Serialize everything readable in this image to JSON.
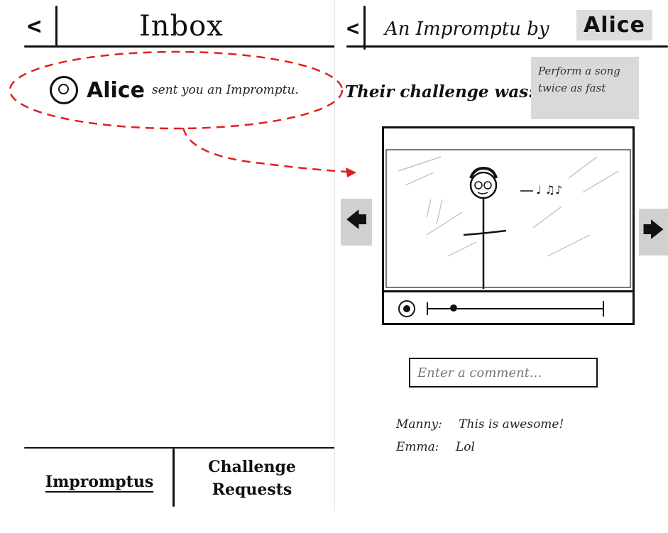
{
  "inbox_screen": {
    "back_label": "<",
    "title": "Inbox",
    "notification": {
      "sender": "Alice",
      "message": "sent you an Impromptu."
    },
    "tabs": [
      {
        "label": "Impromptus",
        "active": true
      },
      {
        "label": "Challenge Requests",
        "active": false
      }
    ]
  },
  "impromptu_screen": {
    "back_label": "<",
    "title_prefix": "An Impromptu by",
    "author": "Alice",
    "challenge_label": "Their challenge was:",
    "challenge_text": "Perform a song twice as fast",
    "prev_arrow": "🡄",
    "next_arrow": "🡆",
    "video": {
      "music_note_text": "♩ ♫♪",
      "playback_progress": 0.15
    },
    "comment_input": {
      "placeholder": "Enter a comment..."
    },
    "comments": [
      {
        "author": "Manny:",
        "text": "This is awesome!"
      },
      {
        "author": "Emma:",
        "text": "Lol"
      }
    ]
  },
  "colors": {
    "ink": "#111111",
    "highlight_gray": "#d9d9d9",
    "annotation_red": "#e02020"
  }
}
